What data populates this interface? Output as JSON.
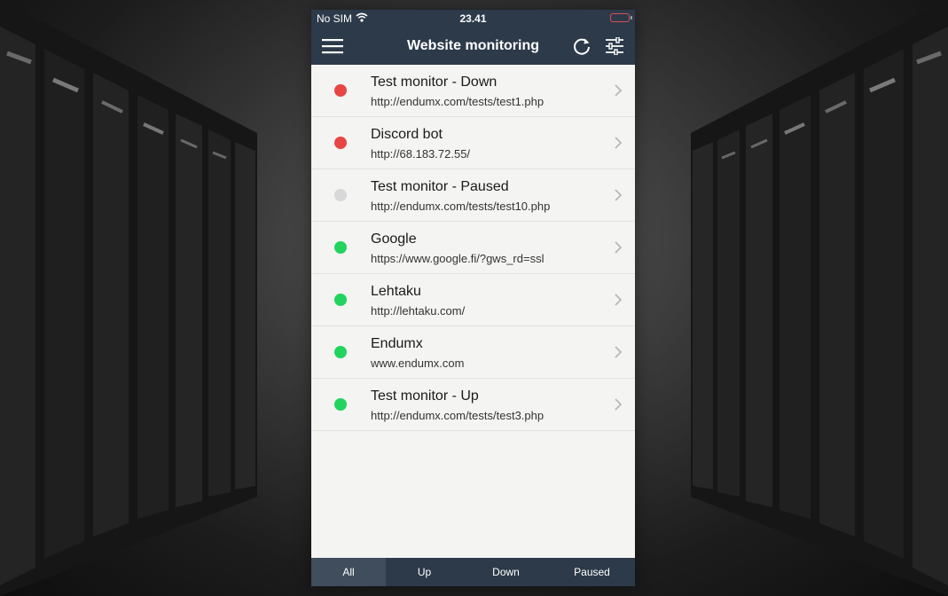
{
  "status_bar": {
    "carrier": "No SIM",
    "time": "23.41",
    "battery_color": "#e05050"
  },
  "nav": {
    "title": "Website monitoring",
    "menu_icon": "hamburger-menu-icon",
    "refresh_icon": "refresh-icon",
    "filter_icon": "sliders-icon"
  },
  "colors": {
    "header_bg": "#2c3a4a",
    "status_down": "#e84545",
    "status_paused": "#d8d8d8",
    "status_up": "#22d45e"
  },
  "monitors": [
    {
      "name": "Test monitor - Down",
      "url": "http://endumx.com/tests/test1.php",
      "status": "down"
    },
    {
      "name": "Discord bot",
      "url": "http://68.183.72.55/",
      "status": "down"
    },
    {
      "name": "Test monitor - Paused",
      "url": "http://endumx.com/tests/test10.php",
      "status": "paused"
    },
    {
      "name": "Google",
      "url": "https://www.google.fi/?gws_rd=ssl",
      "status": "up"
    },
    {
      "name": "Lehtaku",
      "url": "http://lehtaku.com/",
      "status": "up"
    },
    {
      "name": "Endumx",
      "url": "www.endumx.com",
      "status": "up"
    },
    {
      "name": "Test monitor - Up",
      "url": "http://endumx.com/tests/test3.php",
      "status": "up"
    }
  ],
  "tabs": [
    {
      "label": "All",
      "active": true
    },
    {
      "label": "Up",
      "active": false
    },
    {
      "label": "Down",
      "active": false
    },
    {
      "label": "Paused",
      "active": false
    }
  ]
}
